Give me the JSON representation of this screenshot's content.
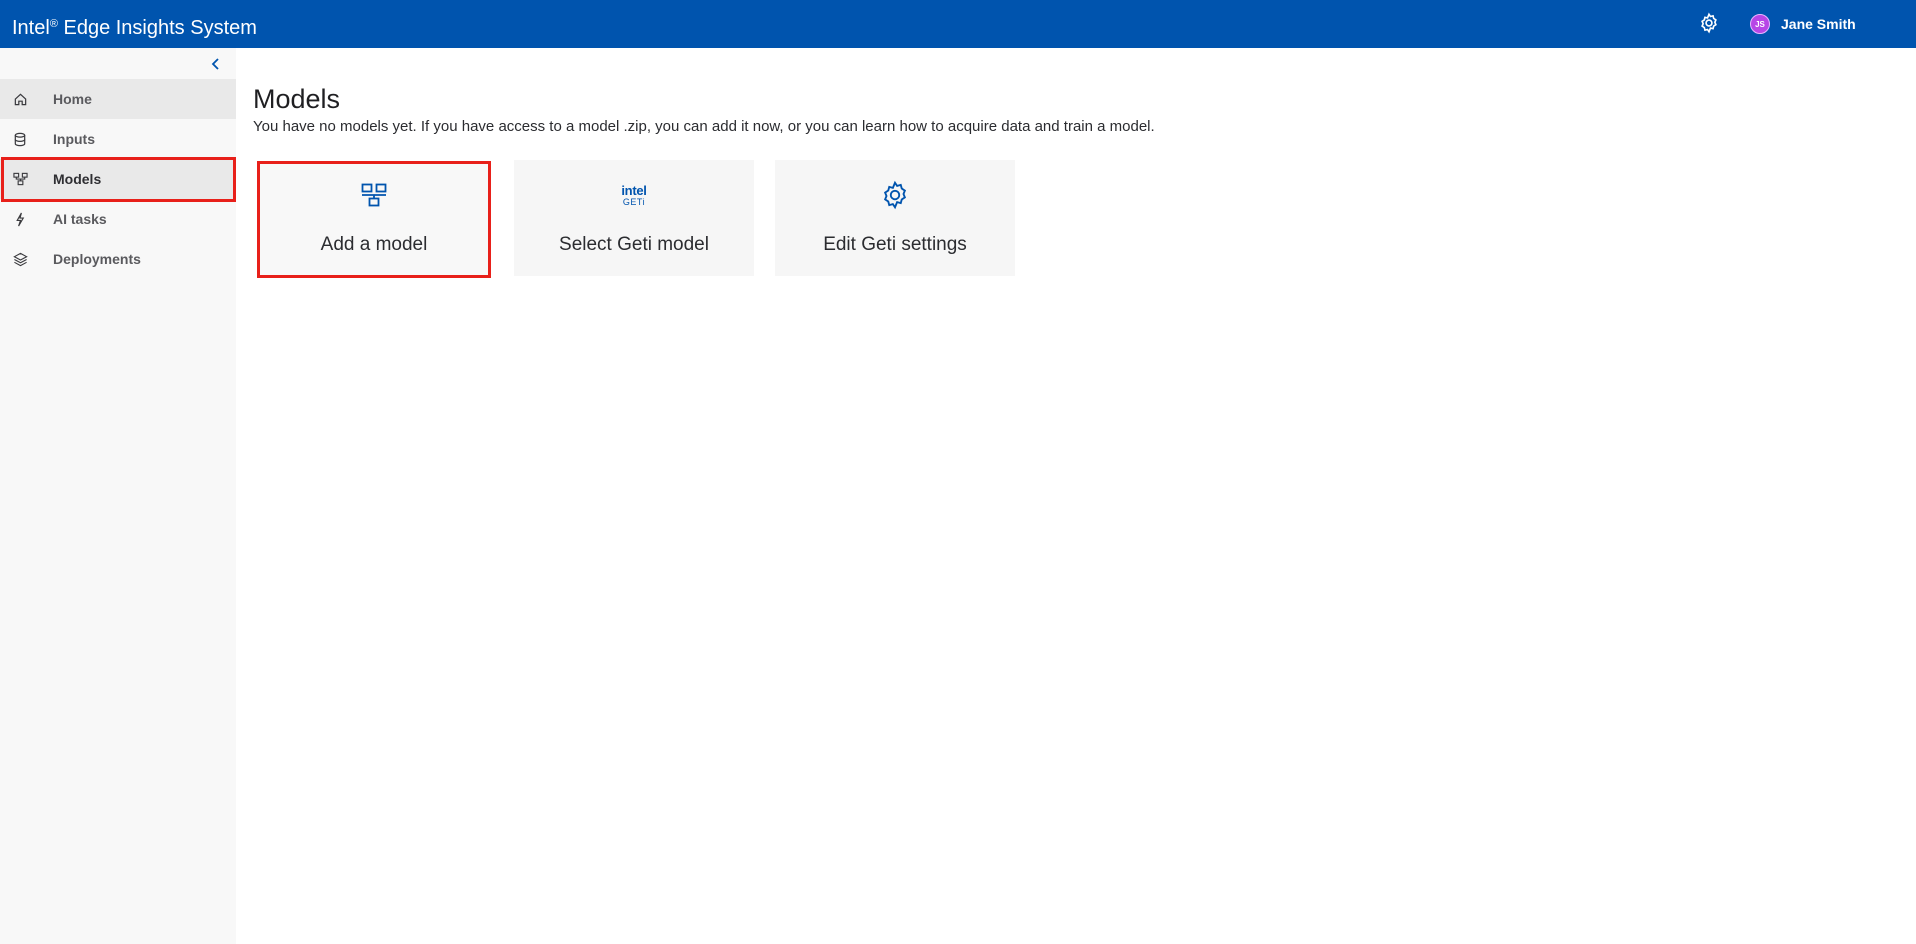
{
  "colors": {
    "brand": "#0054ae",
    "highlight": "#e8201a",
    "icon_blue": "#0054ae",
    "avatar": "#b745e6"
  },
  "header": {
    "title_main": "Intel",
    "title_reg": "®",
    "title_rest": " Edge Insights System",
    "settings_icon": "gear-icon",
    "user": {
      "initials": "JS",
      "name": "Jane Smith"
    }
  },
  "sidebar": {
    "collapse_icon": "chevron-left-icon",
    "items": [
      {
        "label": "Home",
        "icon": "home-icon"
      },
      {
        "label": "Inputs",
        "icon": "database-icon"
      },
      {
        "label": "Models",
        "icon": "model-network-icon",
        "selected": true
      },
      {
        "label": "AI tasks",
        "icon": "lightning-icon"
      },
      {
        "label": "Deployments",
        "icon": "layers-icon"
      }
    ]
  },
  "main": {
    "title": "Models",
    "description": "You have no models yet. If you have access to a model .zip, you can add it now, or you can learn how to acquire data and train a model.",
    "cards": [
      {
        "label": "Add a model",
        "icon": "model-network-icon"
      },
      {
        "label": "Select Geti model",
        "icon": "intel-geti-logo",
        "logo_line1": "intel",
        "logo_line2": "GETi"
      },
      {
        "label": "Edit Geti settings",
        "icon": "gear-icon"
      }
    ]
  }
}
